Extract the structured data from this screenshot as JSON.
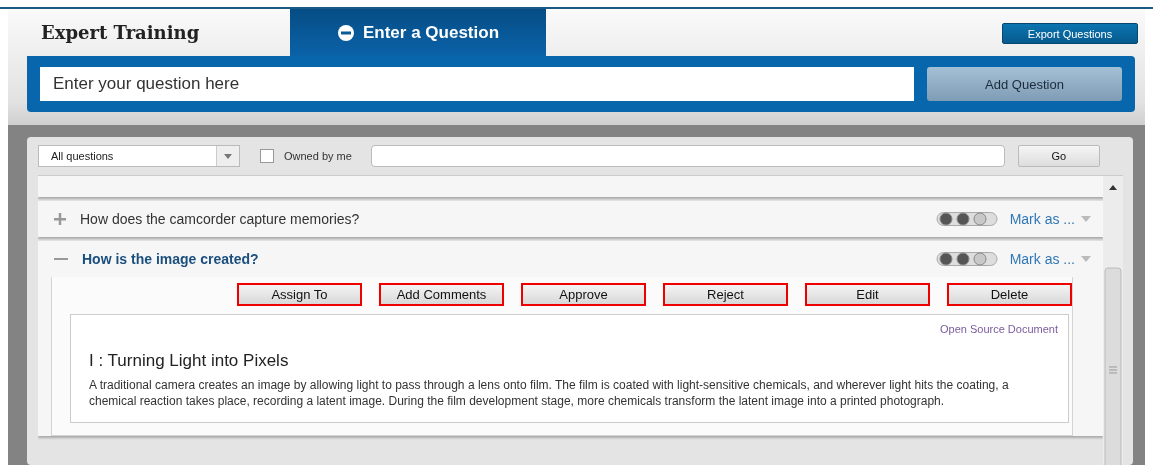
{
  "header": {
    "tabs": [
      {
        "label": "Expert Training",
        "selected": false
      },
      {
        "label": "Enter a Question",
        "selected": true
      }
    ],
    "export_button": "Export Questions",
    "question_field": {
      "placeholder": "Enter your question here"
    },
    "add_button": "Add Question"
  },
  "filter": {
    "dropdown": "All questions",
    "owned_by_me": {
      "label": "Owned by me",
      "checked": false
    },
    "go_button": "Go"
  },
  "questions": [
    {
      "title": "How does the camcorder capture memories?",
      "expanded": false,
      "stars": 2,
      "mark_menu": "Mark as ..."
    },
    {
      "title": "How is the image created?",
      "expanded": true,
      "stars": 2,
      "mark_menu": "Mark as ...",
      "actions": [
        "Assign To",
        "Add Comments",
        "Approve",
        "Reject",
        "Edit",
        "Delete"
      ],
      "document": {
        "link": "Open Source Document",
        "heading": "I : Turning Light into Pixels",
        "body": "A traditional camera creates an image by allowing light to pass through a lens onto film. The film is coated with light-sensitive chemicals, and wherever light hits the coating, a chemical reaction takes place, recording a latent image. During the film development stage, more chemicals transform the latent image into a printed photograph."
      }
    }
  ]
}
